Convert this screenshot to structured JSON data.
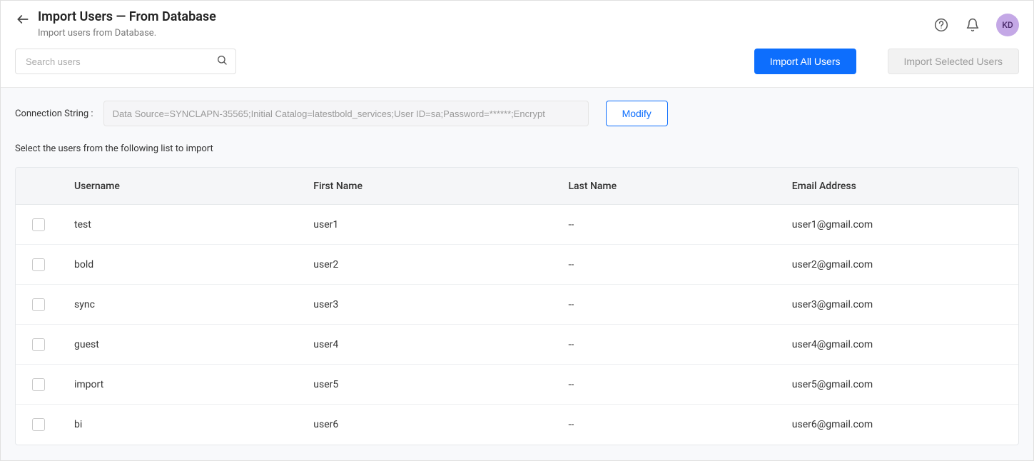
{
  "header": {
    "title": "Import Users — From Database",
    "subtitle": "Import users from Database.",
    "avatar": "KD"
  },
  "toolbar": {
    "search_placeholder": "Search users",
    "import_all_label": "Import All Users",
    "import_selected_label": "Import Selected Users"
  },
  "connection": {
    "label": "Connection String :",
    "value": "Data Source=SYNCLAPN-35565;Initial Catalog=latestbold_services;User ID=sa;Password=******;Encrypt",
    "modify_label": "Modify"
  },
  "instruction": "Select the users from the following list to import",
  "table": {
    "columns": {
      "username": "Username",
      "firstname": "First Name",
      "lastname": "Last Name",
      "email": "Email Address"
    },
    "rows": [
      {
        "username": "test",
        "firstname": "user1",
        "lastname": "--",
        "email": "user1@gmail.com"
      },
      {
        "username": "bold",
        "firstname": "user2",
        "lastname": "--",
        "email": "user2@gmail.com"
      },
      {
        "username": "sync",
        "firstname": "user3",
        "lastname": "--",
        "email": "user3@gmail.com"
      },
      {
        "username": "guest",
        "firstname": "user4",
        "lastname": "--",
        "email": "user4@gmail.com"
      },
      {
        "username": "import",
        "firstname": "user5",
        "lastname": "--",
        "email": "user5@gmail.com"
      },
      {
        "username": "bi",
        "firstname": "user6",
        "lastname": "--",
        "email": "user6@gmail.com"
      }
    ]
  }
}
